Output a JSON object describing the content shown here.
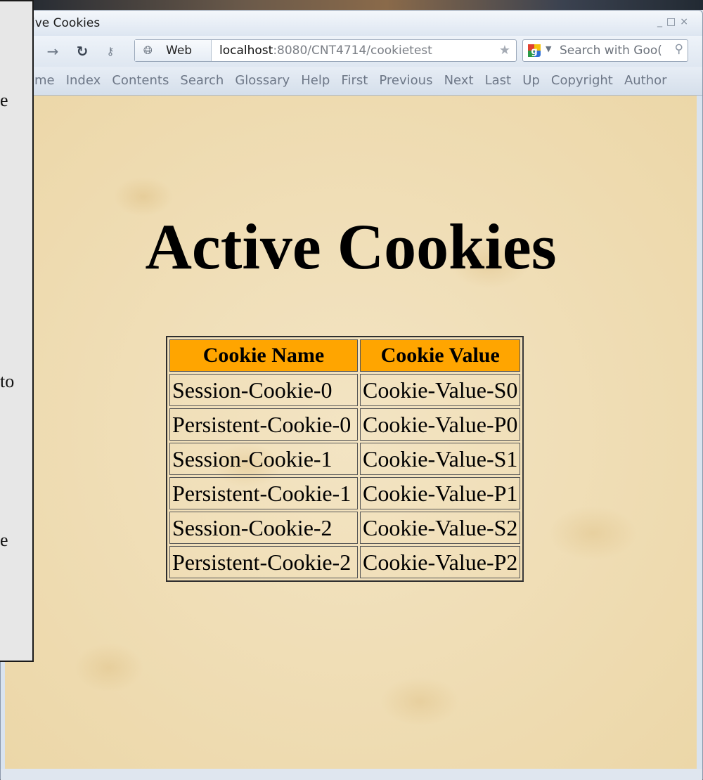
{
  "window": {
    "title": "ctive Cookies",
    "controls": [
      "_",
      "□",
      "×"
    ]
  },
  "toolbar": {
    "forward_icon": "arrow-right-icon",
    "reload_icon": "reload-icon",
    "key_icon": "key-icon",
    "address": {
      "badge_label": "Web",
      "host": "localhost",
      "rest": ":8080/CNT4714/cookietest"
    },
    "search": {
      "placeholder": "Search with Goo("
    }
  },
  "linkbar": {
    "items": [
      "me",
      "Index",
      "Contents",
      "Search",
      "Glossary",
      "Help",
      "First",
      "Previous",
      "Next",
      "Last",
      "Up",
      "Copyright",
      "Author"
    ]
  },
  "page": {
    "heading": "Active Cookies",
    "table": {
      "headers": [
        "Cookie Name",
        "Cookie Value"
      ],
      "rows": [
        [
          "Session-Cookie-0",
          "Cookie-Value-S0"
        ],
        [
          "Persistent-Cookie-0",
          "Cookie-Value-P0"
        ],
        [
          "Session-Cookie-1",
          "Cookie-Value-S1"
        ],
        [
          "Persistent-Cookie-1",
          "Cookie-Value-P1"
        ],
        [
          "Session-Cookie-2",
          "Cookie-Value-S2"
        ],
        [
          "Persistent-Cookie-2",
          "Cookie-Value-P2"
        ]
      ]
    }
  },
  "side_panel": {
    "fragments": [
      "e",
      "to",
      "e"
    ]
  },
  "colors": {
    "table_header_bg": "#ffa500",
    "page_bg": "#f0dfb8"
  }
}
